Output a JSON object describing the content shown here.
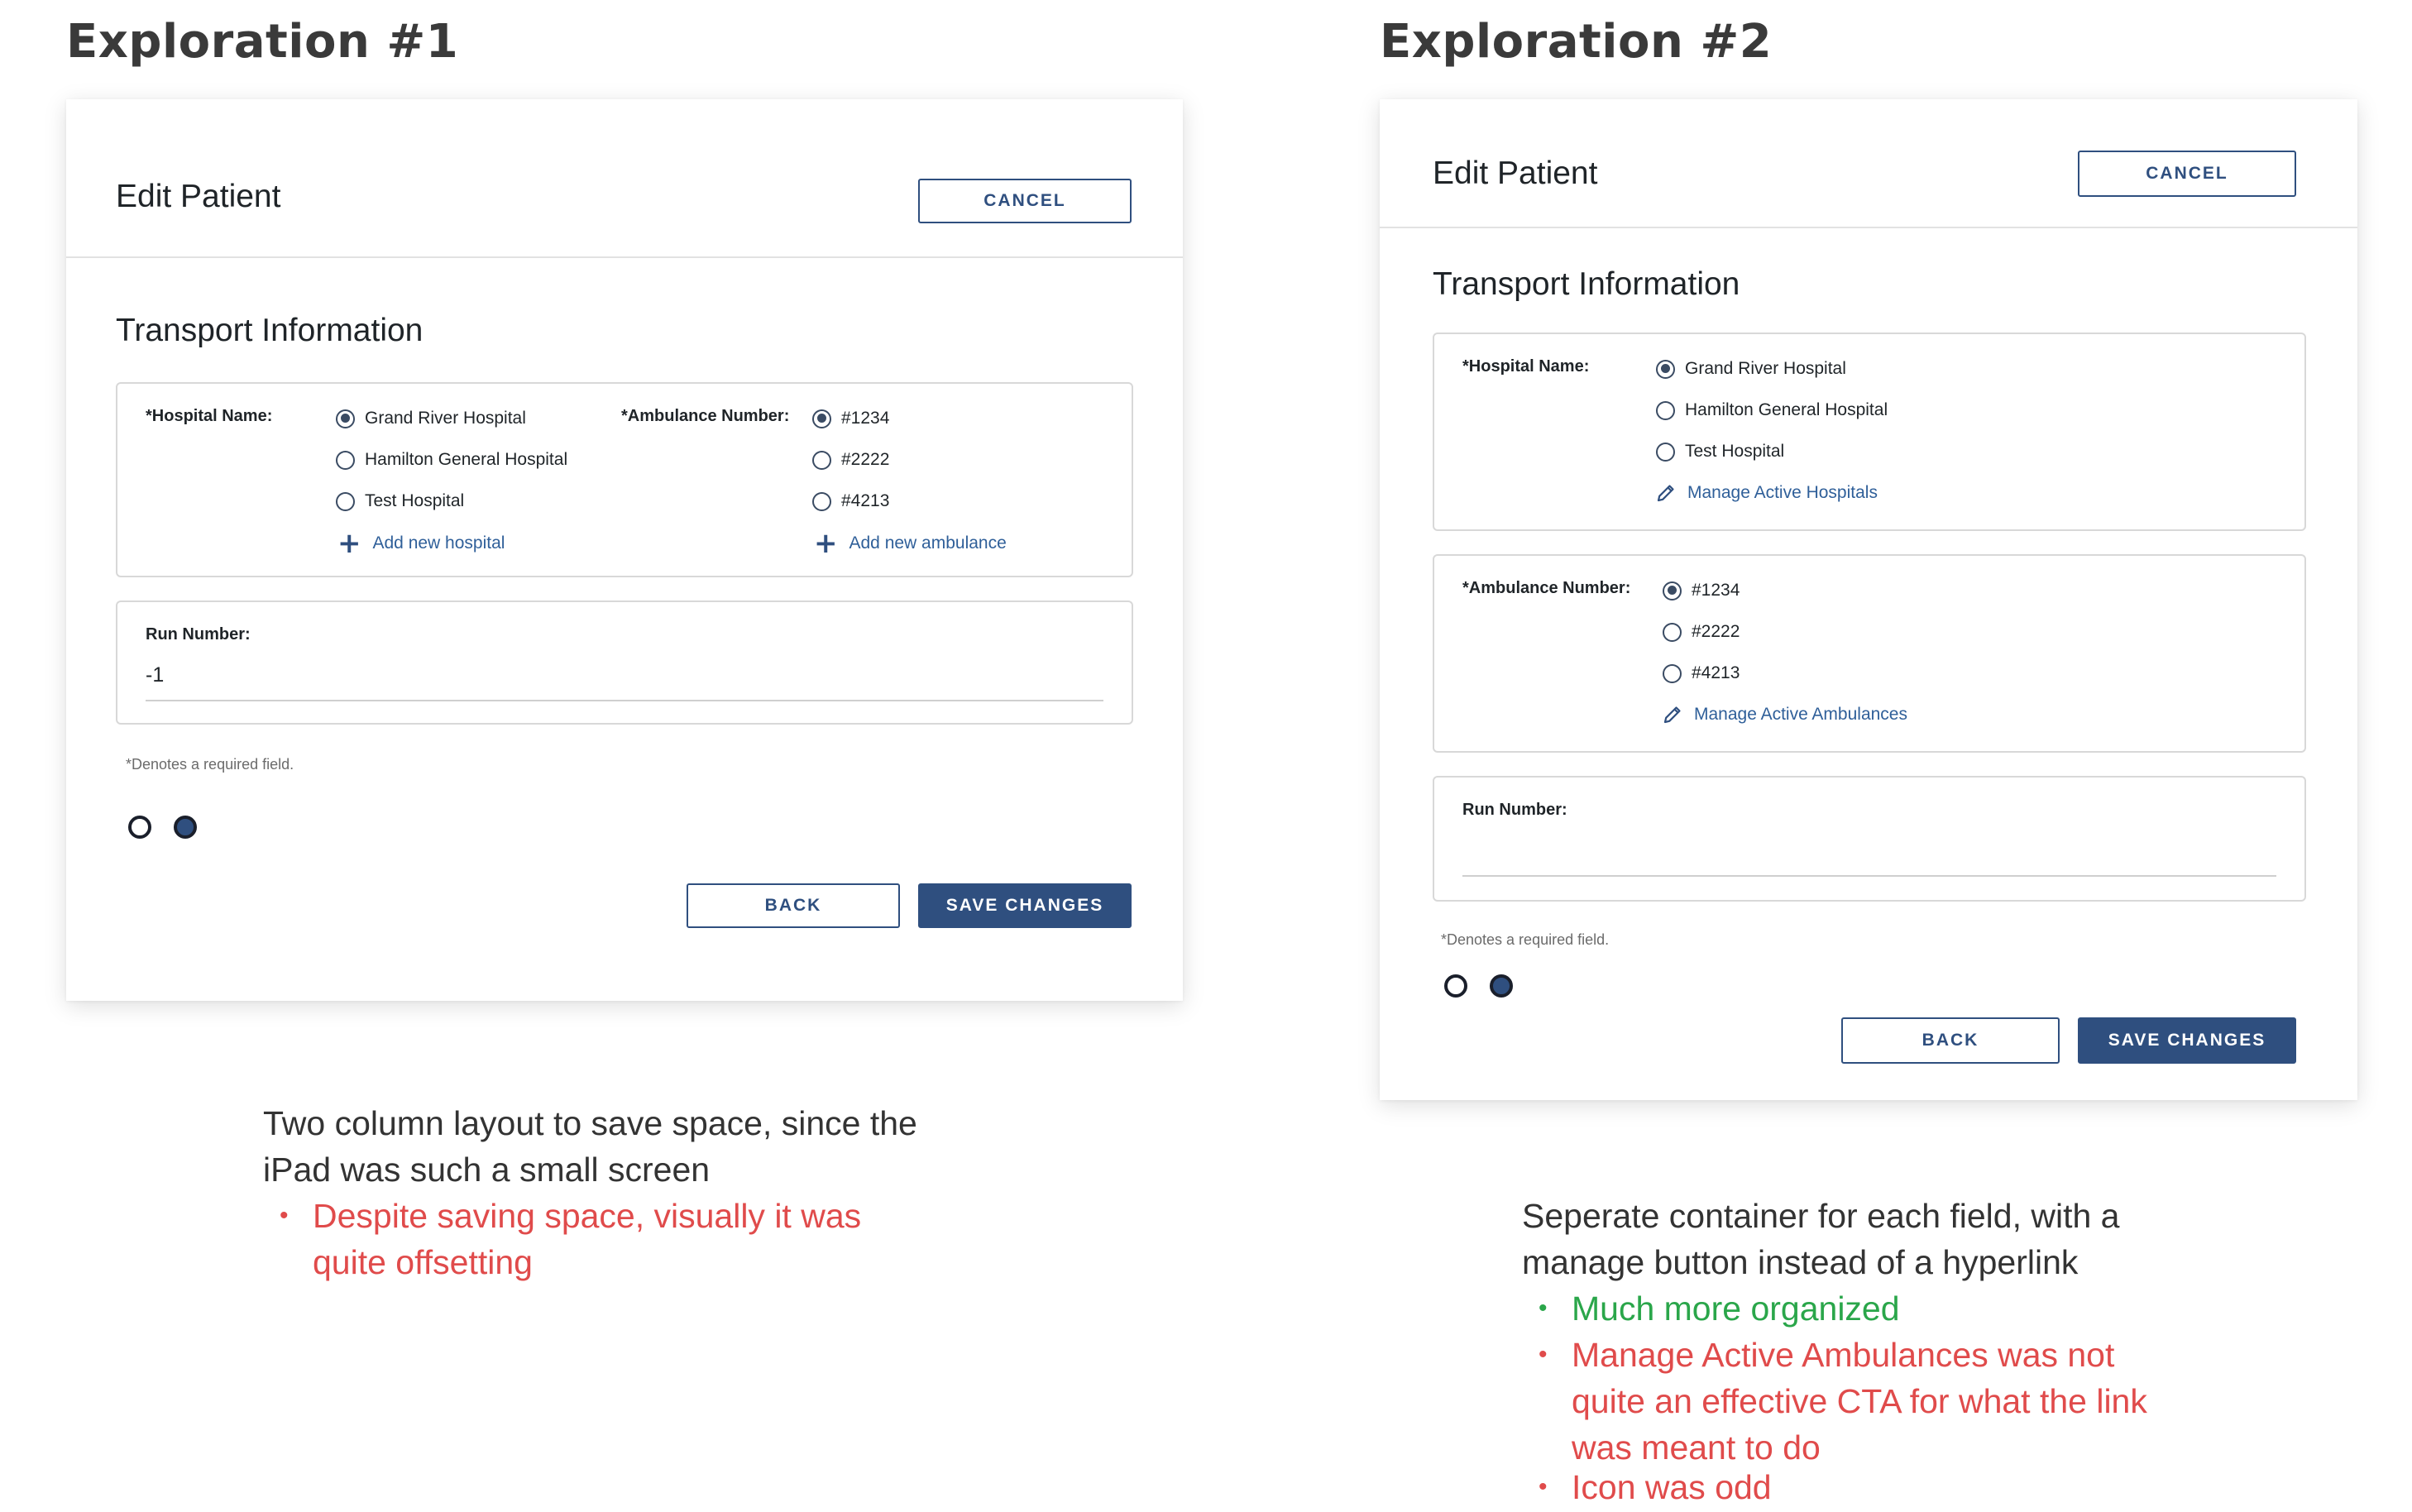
{
  "exploration1": {
    "heading": "Exploration #1",
    "card": {
      "title": "Edit Patient",
      "cancel": "CANCEL",
      "section": "Transport Information",
      "hospital_label": "*Hospital Name:",
      "hospitals": [
        {
          "label": "Grand River Hospital",
          "selected": true
        },
        {
          "label": "Hamilton General Hospital",
          "selected": false
        },
        {
          "label": "Test Hospital",
          "selected": false
        }
      ],
      "add_hospital": "Add new hospital",
      "ambulance_label": "*Ambulance Number:",
      "ambulances": [
        {
          "label": "#1234",
          "selected": true
        },
        {
          "label": "#2222",
          "selected": false
        },
        {
          "label": "#4213",
          "selected": false
        }
      ],
      "add_ambulance": "Add new ambulance",
      "run_label": "Run Number:",
      "run_value": "-1",
      "required_note": "*Denotes a required field.",
      "back": "BACK",
      "save": "SAVE CHANGES"
    },
    "note": {
      "line1": "Two column layout to save space, since the",
      "line2": "iPad was such a small screen",
      "bullet1_line1": "Despite saving space, visually it was",
      "bullet1_line2": "quite offsetting"
    }
  },
  "exploration2": {
    "heading": "Exploration #2",
    "card": {
      "title": "Edit Patient",
      "cancel": "CANCEL",
      "section": "Transport Information",
      "hospital_label": "*Hospital Name:",
      "hospitals": [
        {
          "label": "Grand River Hospital",
          "selected": true
        },
        {
          "label": "Hamilton General Hospital",
          "selected": false
        },
        {
          "label": "Test Hospital",
          "selected": false
        }
      ],
      "manage_hospitals": "Manage Active Hospitals",
      "ambulance_label": "*Ambulance Number:",
      "ambulances": [
        {
          "label": "#1234",
          "selected": true
        },
        {
          "label": "#2222",
          "selected": false
        },
        {
          "label": "#4213",
          "selected": false
        }
      ],
      "manage_ambulances": "Manage Active Ambulances",
      "run_label": "Run Number:",
      "run_value": "",
      "required_note": "*Denotes a required field.",
      "back": "BACK",
      "save": "SAVE CHANGES"
    },
    "note": {
      "line1": "Seperate container for each field, with a",
      "line2": "manage button instead of a hyperlink",
      "bullet1": "Much more organized",
      "bullet2_line1": "Manage Active Ambulances was not",
      "bullet2_line2": "quite an effective CTA for what the link",
      "bullet2_line3": "was meant to do",
      "bullet3": "Icon was odd"
    }
  },
  "colors": {
    "primary": "#2f4f7f",
    "link": "#2f5f99",
    "negative": "#e04b4b",
    "positive": "#2aa64a"
  },
  "icons": {
    "add": "plus-icon",
    "manage": "pencil-icon",
    "bullet": "bullet-dot"
  }
}
